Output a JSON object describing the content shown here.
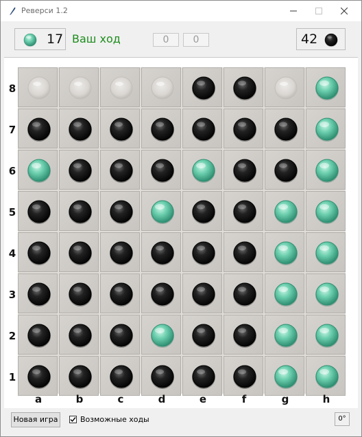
{
  "window": {
    "title": "Реверси 1.2"
  },
  "score": {
    "white": "17",
    "black": "42"
  },
  "status": {
    "turn_label": "Ваш ход"
  },
  "counters": {
    "left": "0",
    "right": "0"
  },
  "board": {
    "files": [
      "a",
      "b",
      "c",
      "d",
      "e",
      "f",
      "g",
      "h"
    ],
    "ranks": [
      "8",
      "7",
      "6",
      "5",
      "4",
      "3",
      "2",
      "1"
    ],
    "rows": [
      "HHHHBBHW",
      "BBBBBBBW",
      "WBBBWBBW",
      "BBBWBBWW",
      "BBBBBBWW",
      "BBBBBBWW",
      "BBBWBBWW",
      "BBBBBBWW"
    ],
    "legend": {
      "B": "black",
      "W": "teal",
      "H": "hint"
    }
  },
  "controls": {
    "new_game": "Новая игра",
    "possible_moves_label": "Возможные ходы",
    "possible_moves_checked": true,
    "rotate_label": "0°"
  },
  "colors": {
    "teal_disc": "#6ccfae",
    "black_disc": "#1a1a1a",
    "turn_text": "#1c8c1c"
  }
}
